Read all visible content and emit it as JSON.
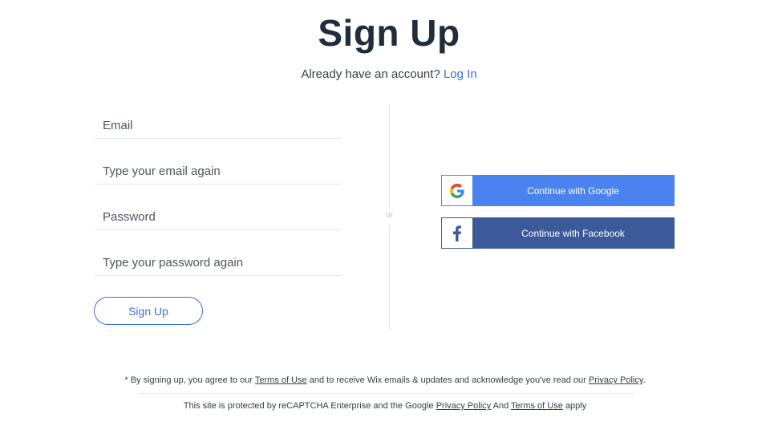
{
  "header": {
    "title": "Sign Up",
    "login_prompt": "Already have an account?",
    "login_link": "Log In"
  },
  "form": {
    "email_placeholder": "Email",
    "email_confirm_placeholder": "Type your email again",
    "password_placeholder": "Password",
    "password_confirm_placeholder": "Type your password again",
    "submit_label": "Sign Up"
  },
  "divider": {
    "label": "or"
  },
  "social": {
    "google_label": "Continue with Google",
    "facebook_label": "Continue with Facebook",
    "google_icon": "google-icon",
    "facebook_icon": "facebook-icon"
  },
  "footer": {
    "legal_prefix": "* By signing up, you agree to our",
    "terms_link": "Terms of Use",
    "legal_middle": "and to receive Wix emails & updates and acknowledge you've read our",
    "privacy_link": "Privacy Policy",
    "legal_suffix": ".",
    "recaptcha_prefix": "This site is protected by reCAPTCHA Enterprise and the Google",
    "recaptcha_privacy_link": "Privacy Policy",
    "recaptcha_and": "And",
    "recaptcha_terms_link": "Terms of Use",
    "recaptcha_suffix": "apply"
  },
  "colors": {
    "accent": "#3b6fd8",
    "google": "#4a83f0",
    "facebook": "#3c5a99",
    "title": "#1f2d3d"
  }
}
